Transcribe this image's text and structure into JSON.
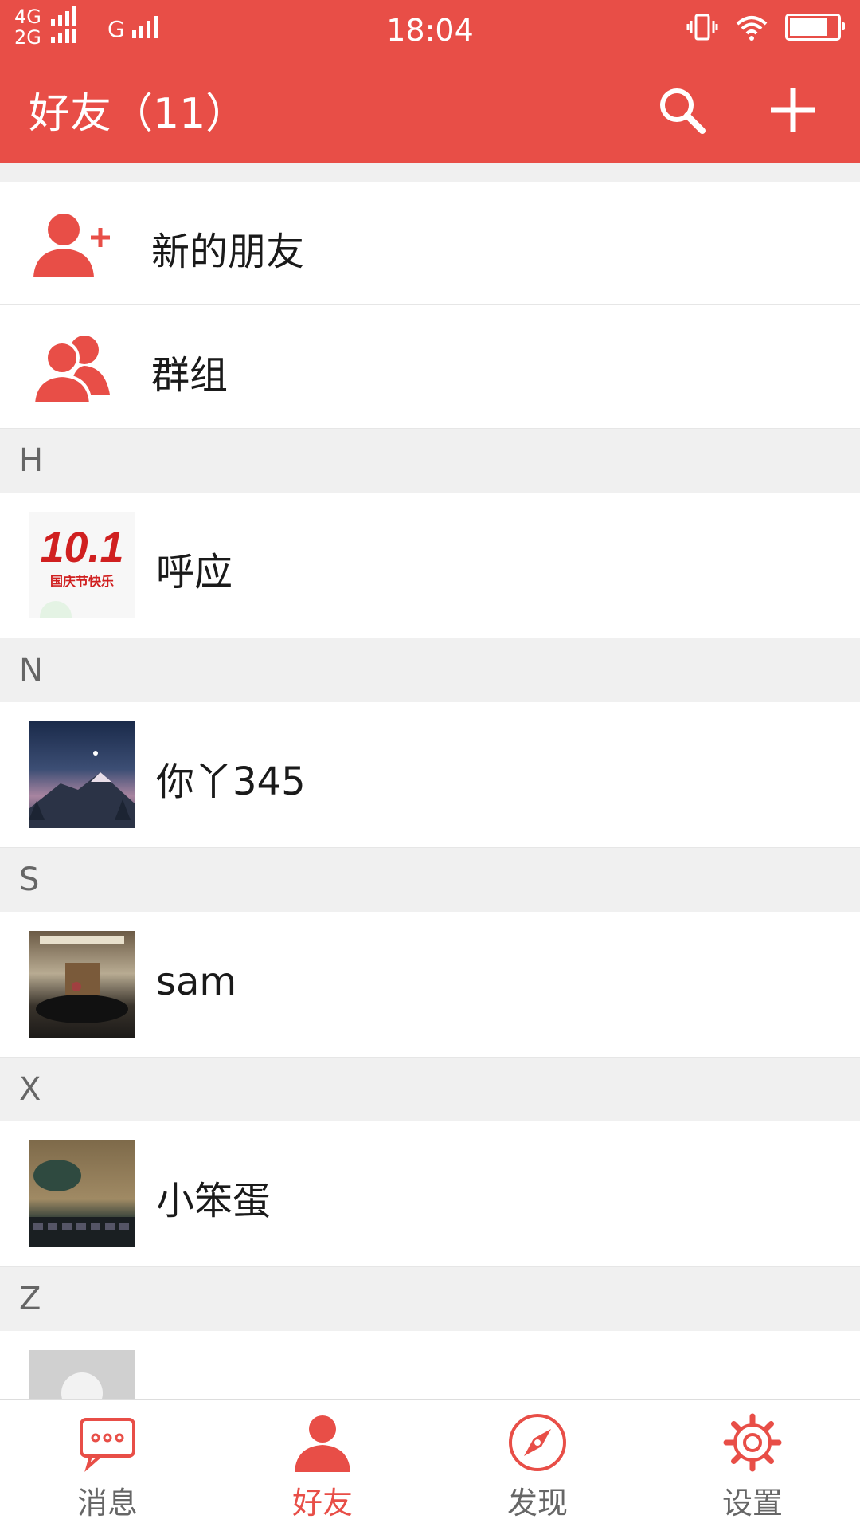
{
  "status": {
    "net1": "4G",
    "net2": "2G",
    "net3": "G",
    "time": "18:04"
  },
  "header": {
    "title": "好友（11）"
  },
  "colors": {
    "accent": "#e84e47"
  },
  "icons": {
    "search": "search-icon",
    "add": "plus-icon",
    "new_friend": "add-user-icon",
    "group": "group-icon"
  },
  "fixed_items": [
    {
      "label": "新的朋友"
    },
    {
      "label": "群组"
    }
  ],
  "sections": [
    {
      "letter": "H",
      "contacts": [
        {
          "name": "呼应",
          "avatar_text_big": "10.1",
          "avatar_text_small": "国庆节快乐"
        }
      ]
    },
    {
      "letter": "N",
      "contacts": [
        {
          "name": "你丫345"
        }
      ]
    },
    {
      "letter": "S",
      "contacts": [
        {
          "name": "sam"
        }
      ]
    },
    {
      "letter": "X",
      "contacts": [
        {
          "name": "小笨蛋"
        }
      ]
    },
    {
      "letter": "Z",
      "contacts": [
        {
          "name": ""
        }
      ]
    }
  ],
  "tabs": [
    {
      "label": "消息",
      "icon": "message-icon",
      "active": false
    },
    {
      "label": "好友",
      "icon": "person-icon",
      "active": true
    },
    {
      "label": "发现",
      "icon": "compass-icon",
      "active": false
    },
    {
      "label": "设置",
      "icon": "gear-icon",
      "active": false
    }
  ]
}
